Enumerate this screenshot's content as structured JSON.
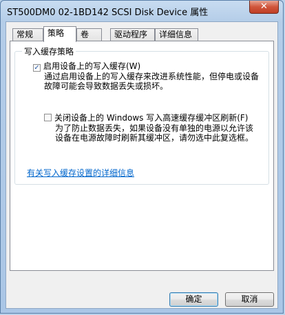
{
  "window": {
    "title": "ST500DM0 02-1BD142 SCSI Disk Device 属性",
    "close_glyph": "✕"
  },
  "tabs": [
    {
      "label": "常规",
      "active": false
    },
    {
      "label": "策略",
      "active": true
    },
    {
      "label": "卷",
      "active": false
    },
    {
      "label": "驱动程序",
      "active": false
    },
    {
      "label": "详细信息",
      "active": false
    }
  ],
  "write_cache": {
    "group_label": "写入缓存策略",
    "enable": {
      "label": "启用设备上的写入缓存(W)",
      "checked": true,
      "description_lines": [
        "通过启用设备上的写入缓存来改进系统性能，但停电或设备",
        "故障可能会导致数据丢失或损坏。"
      ]
    },
    "flush": {
      "label": "关闭设备上的 Windows 写入高速缓存缓冲区刷新(F)",
      "checked": false,
      "description_lines": [
        "为了防止数据丢失，如果设备没有单独的电源以允许该",
        "设备在电源故障时刷新其缓冲区，请勿选中此复选框。"
      ]
    },
    "link": "有关写入缓存设置的详细信息"
  },
  "buttons": {
    "ok": "确定",
    "cancel": "取消"
  }
}
